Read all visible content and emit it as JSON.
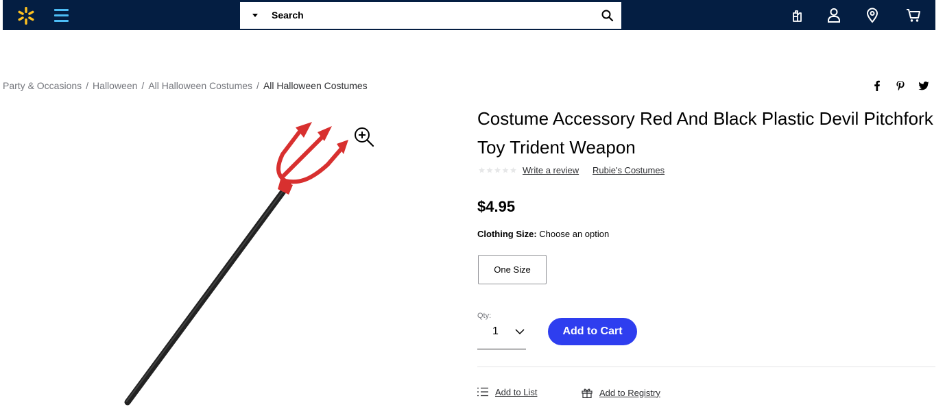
{
  "header": {
    "logo_icon": "walmart-spark-icon",
    "menu_icon": "hamburger-menu-icon",
    "search": {
      "placeholder": "Search",
      "search_icon": "search-icon",
      "dropdown_icon": "caret-down-icon"
    },
    "nav_icons": [
      "reorder-icon",
      "account-icon",
      "location-icon",
      "cart-icon"
    ],
    "colors": {
      "bar": "#041e42",
      "spark": "#ffc220",
      "menu": "#4dbdf5"
    }
  },
  "breadcrumb": {
    "items": [
      "Party & Occasions",
      "Halloween",
      "All Halloween Costumes",
      "All Halloween Costumes"
    ],
    "separator": "/"
  },
  "share_icons": [
    "facebook-icon",
    "pinterest-icon",
    "twitter-icon"
  ],
  "product": {
    "title": "Costume Accessory Red And Black Plastic Devil Pitchfork Toy Trident Weapon",
    "rating_stars": 0,
    "write_review": "Write a review",
    "brand": "Rubie's Costumes",
    "price": "$4.95",
    "size_label": "Clothing Size:",
    "size_prompt": "Choose an option",
    "size_option": "One Size",
    "qty_label": "Qty:",
    "qty_value": "1",
    "add_to_cart": "Add to Cart",
    "add_to_list": "Add to List",
    "add_to_registry": "Add to Registry",
    "zoom_icon": "zoom-in-icon",
    "colors": {
      "add_to_cart": "#2e3eef",
      "pitchfork_head": "#d8302f",
      "pitchfork_handle": "#111111"
    }
  }
}
